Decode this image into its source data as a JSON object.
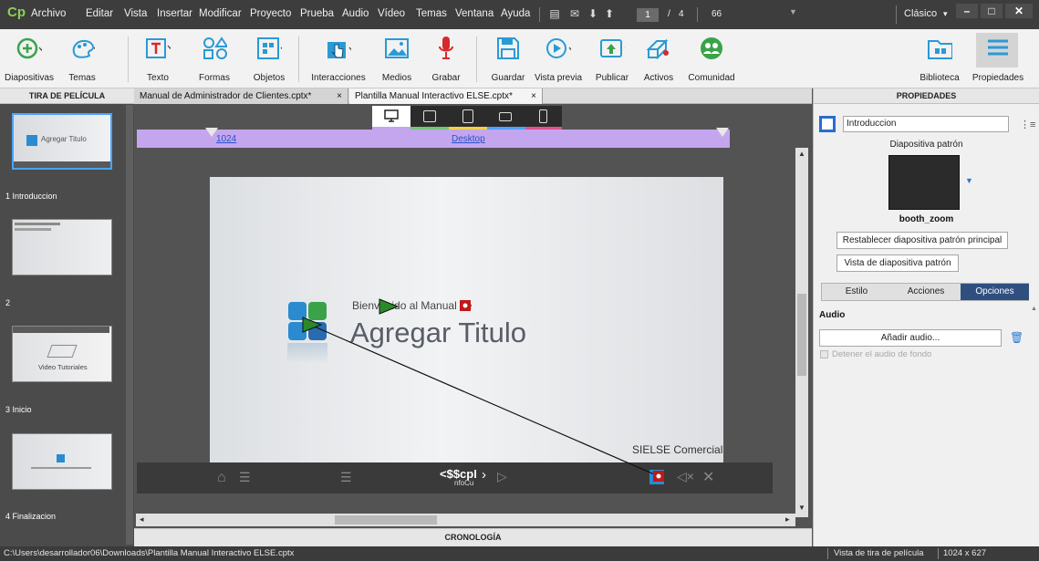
{
  "app": {
    "logo": "Cp"
  },
  "menu": [
    "Archivo",
    "Editar",
    "Vista",
    "Insertar",
    "Modificar",
    "Proyecto",
    "Prueba",
    "Audio",
    "Vídeo",
    "Temas",
    "Ventana",
    "Ayuda"
  ],
  "titlebar": {
    "page_current": "1",
    "page_sep": "/",
    "page_total": "4",
    "zoom": "66",
    "workspace": "Clásico"
  },
  "toolbar": {
    "diapositivas": "Diapositivas",
    "temas": "Temas",
    "texto": "Texto",
    "formas": "Formas",
    "objetos": "Objetos",
    "interacciones": "Interacciones",
    "medios": "Medios",
    "grabar": "Grabar",
    "guardar": "Guardar",
    "vista_previa": "Vista previa",
    "publicar": "Publicar",
    "activos": "Activos",
    "comunidad": "Comunidad",
    "biblioteca": "Biblioteca",
    "propiedades": "Propiedades"
  },
  "filmstrip": {
    "header": "TIRA DE PELÍCULA",
    "slides": [
      {
        "label": "1 Introduccion",
        "thumb_text": "Agregar Titulo"
      },
      {
        "label": "2",
        "thumb_text": ""
      },
      {
        "label": "3 Inicio",
        "thumb_text": "Video Tutoriales"
      },
      {
        "label": "4 Finalizacion",
        "thumb_text": ""
      }
    ]
  },
  "tabs": [
    {
      "label": "Manual de Administrador de Clientes.cptx*",
      "close": "×"
    },
    {
      "label": "Plantilla Manual Interactivo ELSE.cptx*",
      "close": "×"
    }
  ],
  "stage": {
    "ruler_width": "1024",
    "ruler_mode": "Desktop",
    "slide_subtitle": "Bienvenido al Manual de",
    "slide_title": "Agregar Titulo",
    "slide_footer": "SIELSE Comercial",
    "playbar_text": "<$$cpI",
    "playbar_text2": "nfoCu"
  },
  "cronologia": "CRONOLOGÍA",
  "properties": {
    "header": "PROPIEDADES",
    "slide_name": "Introduccion",
    "master_label": "Diapositiva patrón",
    "master_name": "booth_zoom",
    "reset_button": "Restablecer diapositiva patrón principal",
    "view_button": "Vista de diapositiva patrón",
    "tabs": [
      "Estilo",
      "Acciones",
      "Opciones"
    ],
    "audio_header": "Audio",
    "add_audio": "Añadir audio...",
    "stop_bg_audio": "Detener el audio de fondo"
  },
  "status": {
    "path": "C:\\Users\\desarrollador06\\Downloads\\Plantilla Manual Interactivo ELSE.cptx",
    "view": "Vista de tira de película",
    "size": "1024 x 627"
  },
  "colors": {
    "accent": "#4aa3ff",
    "ruler": "#c4a6ee",
    "titlebar": "#3d3d3d"
  }
}
